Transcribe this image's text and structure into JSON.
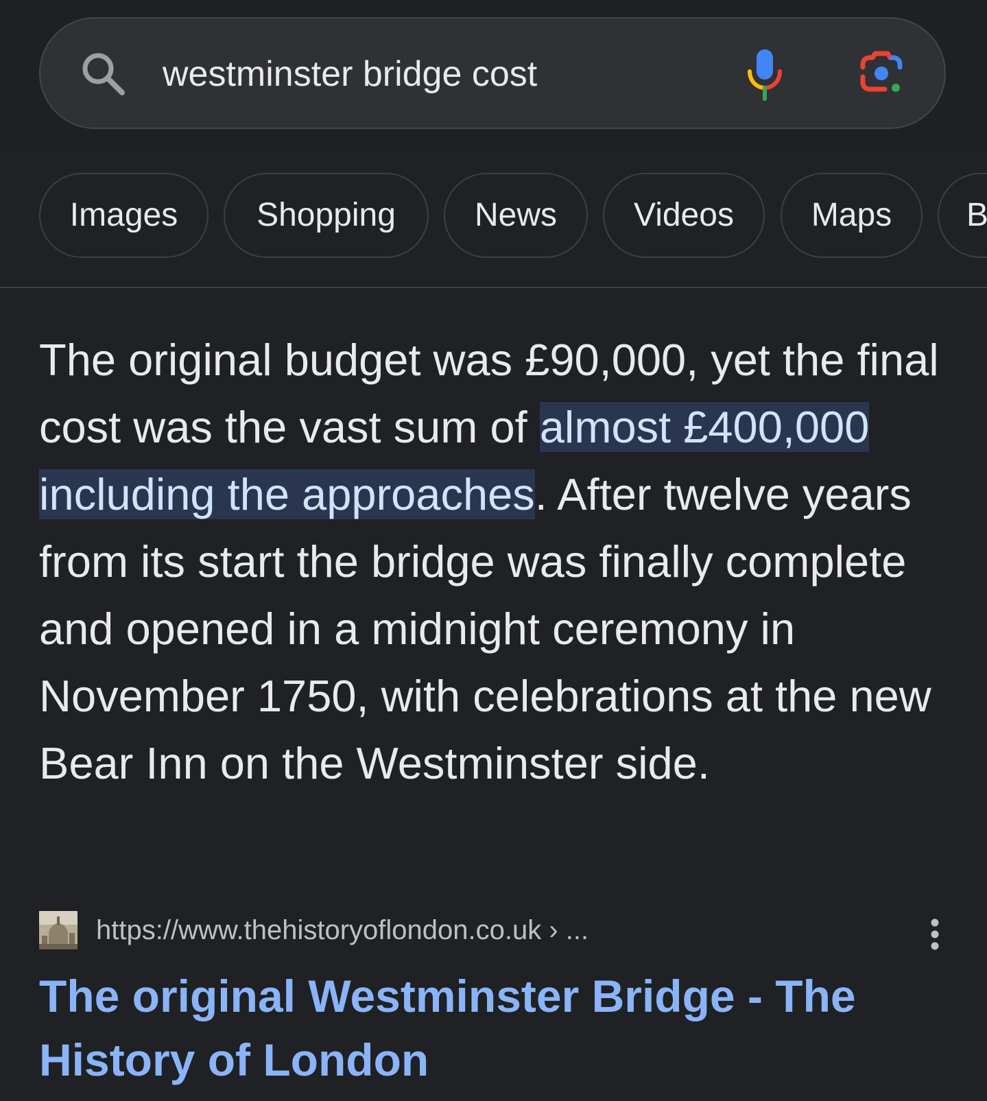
{
  "search": {
    "query": "westminster bridge cost"
  },
  "icons": {
    "search": "search-icon",
    "voice": "microphone-icon",
    "lens": "lens-camera-icon",
    "more": "more-vert-icon"
  },
  "tabs": [
    {
      "label": "Images"
    },
    {
      "label": "Shopping"
    },
    {
      "label": "News"
    },
    {
      "label": "Videos"
    },
    {
      "label": "Maps"
    },
    {
      "label": "B"
    }
  ],
  "snippet": {
    "before": "The original budget was £90,000, yet the final cost was the vast sum of ",
    "highlight": "almost £400,000 including the approaches",
    "after": ". After twelve years from its start the bridge was finally complete and opened in a midnight ceremony in November 1750, with celebrations at the new Bear Inn on the Westminster side."
  },
  "result": {
    "url": "https://www.thehistoryoflondon.co.uk › ...",
    "title": "The original Westminster Bridge - The History of London"
  },
  "colors": {
    "background": "#202124",
    "link": "#8ab4f8",
    "highlight_bg": "#2a3650",
    "google_blue": "#4285f4",
    "google_red": "#ea4335",
    "google_yellow": "#fbbc04",
    "google_green": "#34a853"
  }
}
